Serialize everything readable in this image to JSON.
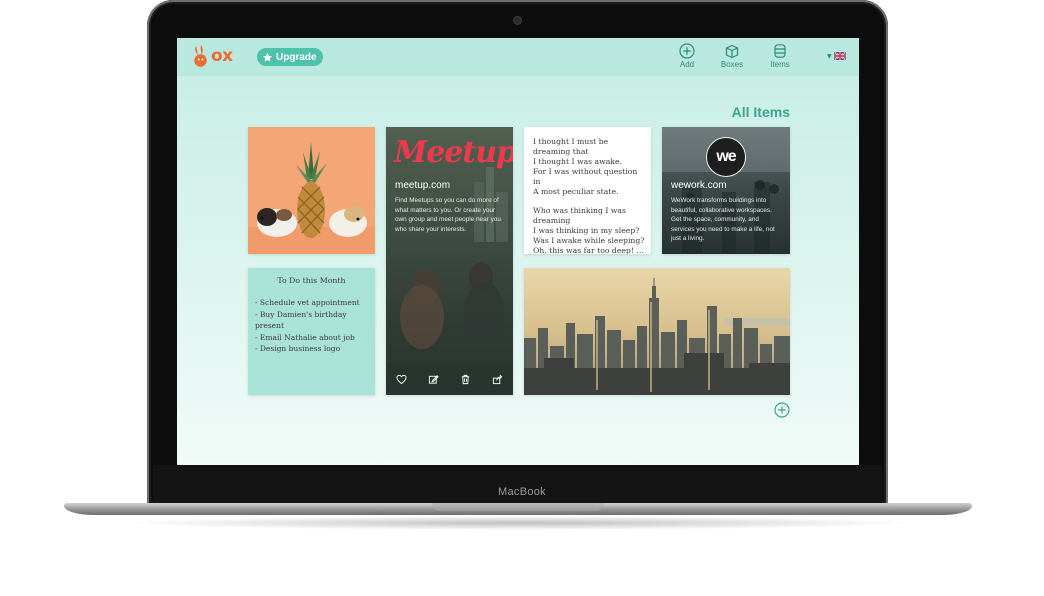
{
  "device": {
    "brand": "MacBook"
  },
  "app": {
    "logo_text": "ox",
    "upgrade_label": "Upgrade",
    "nav": [
      {
        "label": "Add",
        "icon": "plus-circle-icon"
      },
      {
        "label": "Boxes",
        "icon": "box-icon"
      },
      {
        "label": "Items",
        "icon": "items-icon"
      }
    ],
    "language_icon": "uk-flag-icon",
    "page_title": "All Items"
  },
  "cards": {
    "photo1": {
      "icon": "pineapple-guinea-pigs-photo"
    },
    "meetup": {
      "logo": "Meetup",
      "title": "meetup.com",
      "description": "Find Meetups so you can do more of what matters to you. Or create your own group and meet people near you who share your interests.",
      "actions": [
        "heart-icon",
        "edit-icon",
        "trash-icon",
        "share-icon"
      ]
    },
    "poem": {
      "text": "I thought I must be dreaming that\nI thought I was awake.\nFor I was without question in\nA most peculiar state.\n\nWho was thinking I was dreaming\nI was thinking in my sleep?\nWas I awake while sleeping?\nOh, this was far too deep! …"
    },
    "wework": {
      "logo": "we",
      "title": "wework.com",
      "description": "WeWork transforms buildings into beautiful, collaborative workspaces. Get the space, community, and services you need to make a life, not just a living."
    },
    "todo": {
      "title": "To Do this Month",
      "items": [
        "- Schedule vet appointment",
        "- Buy Damien's birthday present",
        "- Email Nathalie about job",
        "- Design business logo"
      ]
    },
    "city": {
      "icon": "city-skyline-photo"
    }
  },
  "colors": {
    "accent": "#3aa591",
    "upgrade": "#4fc2ab",
    "logo": "#ee6a32",
    "meetup": "#ee3a4c"
  }
}
